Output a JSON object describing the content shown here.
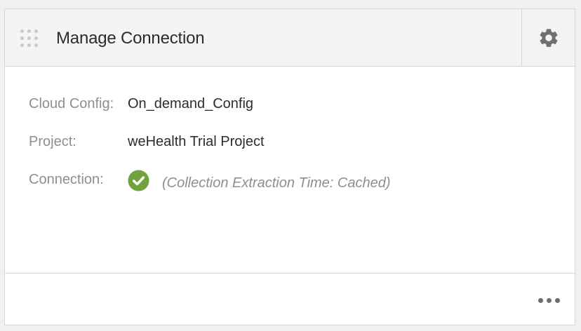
{
  "card": {
    "title": "Manage Connection",
    "rows": [
      {
        "label": "Cloud Config:",
        "value": "On_demand_Config"
      },
      {
        "label": "Project:",
        "value": "weHealth Trial Project"
      },
      {
        "label": "Connection:",
        "status_note": "(Collection Extraction Time: Cached)"
      }
    ]
  },
  "icons": {
    "drag": "drag-handle-icon",
    "settings": "gear-icon",
    "status": "check-circle-icon",
    "more": "more-horizontal-icon"
  },
  "colors": {
    "status_ok": "#70a33e",
    "header_bg": "#f4f4f4",
    "text_primary": "#2c2c2c",
    "text_secondary": "#8e8e8e"
  }
}
